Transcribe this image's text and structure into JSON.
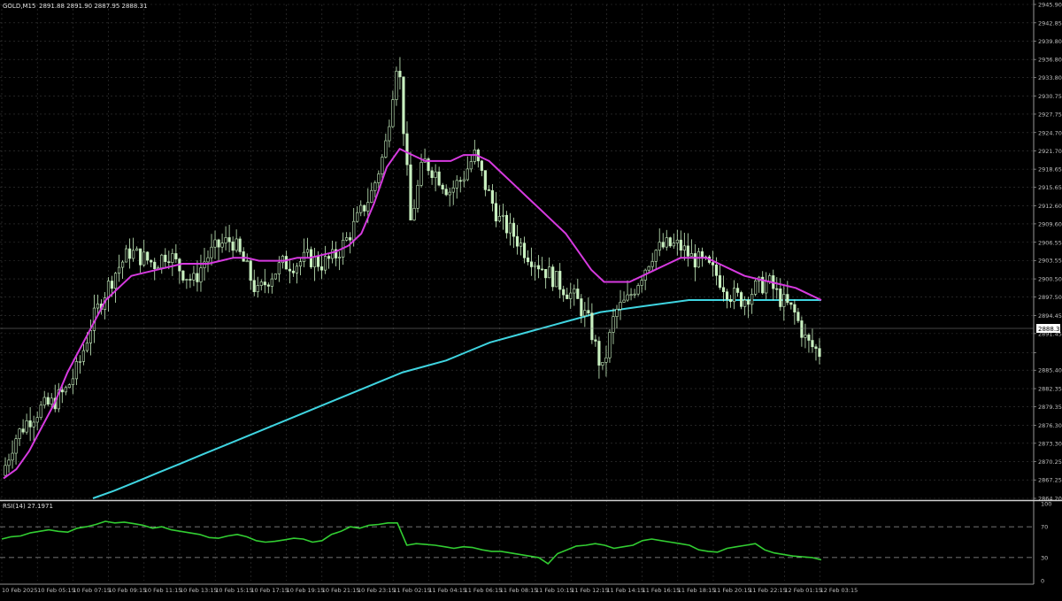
{
  "header": {
    "symbol": "GOLD,M15",
    "ohlc": "2891.88 2891.90 2887.95 2888.31"
  },
  "rsi_header": {
    "label": "RSI(14) 27.1971"
  },
  "current_price_label": "2888.31",
  "colors": {
    "background": "#000000",
    "grid": "#3a3a3a",
    "candle": "#c8f0c0",
    "ma_fast": "#d63adf",
    "ma_slow": "#3fd4e0",
    "rsi": "#32cd32",
    "axis": "#bfbfbf",
    "text": "#e0e0e0"
  },
  "chart_data": [
    {
      "type": "line",
      "title": "GOLD,M15",
      "ylim": [
        2864.2,
        2945.9
      ],
      "y_ticks": [
        "2945.90",
        "2942.85",
        "2939.80",
        "2936.80",
        "2933.80",
        "2930.75",
        "2927.75",
        "2924.70",
        "2921.70",
        "2918.65",
        "2915.65",
        "2912.60",
        "2909.60",
        "2906.55",
        "2903.55",
        "2900.50",
        "2897.50",
        "2894.45",
        "2891.45",
        "2888.31",
        "2885.40",
        "2882.35",
        "2879.35",
        "2876.30",
        "2873.30",
        "2870.25",
        "2867.25",
        "2864.20"
      ],
      "x_ticks": [
        "10 Feb 2025",
        "10 Feb 05:15",
        "10 Feb 07:15",
        "10 Feb 09:15",
        "10 Feb 11:15",
        "10 Feb 13:15",
        "10 Feb 15:15",
        "10 Feb 17:15",
        "10 Feb 19:15",
        "10 Feb 21:15",
        "10 Feb 23:15",
        "11 Feb 02:15",
        "11 Feb 04:15",
        "11 Feb 06:15",
        "11 Feb 08:15",
        "11 Feb 10:15",
        "11 Feb 12:15",
        "11 Feb 14:15",
        "11 Feb 16:15",
        "11 Feb 18:15",
        "11 Feb 20:15",
        "11 Feb 22:15",
        "12 Feb 01:15",
        "12 Feb 03:15"
      ],
      "price_path": [
        2868,
        2874,
        2877,
        2879,
        2880,
        2882,
        2886,
        2893,
        2898,
        2902,
        2905,
        2904,
        2903,
        2905,
        2902,
        2900,
        2904,
        2906,
        2907,
        2903,
        2898,
        2901,
        2903,
        2903,
        2904,
        2903,
        2904,
        2907,
        2911,
        2915,
        2922,
        2938,
        2910,
        2920,
        2918,
        2915,
        2917,
        2921,
        2915,
        2910,
        2908,
        2905,
        2903,
        2901,
        2899,
        2897,
        2893,
        2885,
        2895,
        2897,
        2901,
        2905,
        2906,
        2906,
        2904,
        2903,
        2901,
        2898,
        2897,
        2899,
        2900,
        2897,
        2895,
        2890,
        2888.31
      ],
      "series": [
        {
          "values": [
            2867.5,
            2869,
            2872,
            2876,
            2880,
            2885,
            2889,
            2893,
            2897,
            2899,
            2901,
            2901.5,
            2902,
            2902.5,
            2903,
            2903,
            2903,
            2903.5,
            2904,
            2904,
            2903.5,
            2903.5,
            2903.5,
            2904,
            2904,
            2904.5,
            2905,
            2906,
            2908,
            2913,
            2919,
            2922,
            2921,
            2920,
            2920,
            2920,
            2921,
            2921,
            2920,
            2918,
            2916,
            2914,
            2912,
            2910,
            2908,
            2905,
            2902,
            2900,
            2900,
            2900,
            2901,
            2902,
            2903,
            2904,
            2904,
            2904,
            2903,
            2902,
            2901,
            2900.5,
            2900,
            2899.5,
            2899,
            2898,
            2897
          ]
        },
        {
          "values": [
            2864.2,
            2865.5,
            2867,
            2868.5,
            2870,
            2871.5,
            2873,
            2874.5,
            2876,
            2877.5,
            2879,
            2880.5,
            2882,
            2883.5,
            2885,
            2886,
            2887,
            2888.5,
            2890,
            2891,
            2892,
            2893,
            2894,
            2895,
            2895.5,
            2896,
            2896.5,
            2897,
            2897,
            2897,
            2897,
            2897,
            2897,
            2897
          ]
        },
        {
          "name": "RSI(14)",
          "ylim": [
            0,
            100
          ],
          "levels": [
            70,
            30
          ],
          "y_ticks": [
            "100",
            "70",
            "30",
            "0"
          ],
          "values": [
            54,
            57,
            58,
            62,
            64,
            66,
            64,
            63,
            68,
            70,
            73,
            77,
            75,
            76,
            74,
            72,
            68,
            70,
            66,
            64,
            62,
            60,
            56,
            55,
            58,
            60,
            57,
            52,
            50,
            51,
            53,
            55,
            54,
            50,
            52,
            60,
            64,
            70,
            68,
            72,
            73,
            75,
            75,
            46,
            48,
            47,
            46,
            44,
            42,
            44,
            43,
            40,
            38,
            38,
            36,
            34,
            32,
            30,
            22,
            35,
            40,
            45,
            46,
            48,
            46,
            42,
            44,
            46,
            52,
            54,
            52,
            50,
            48,
            46,
            40,
            38,
            37,
            42,
            44,
            46,
            48,
            40,
            36,
            34,
            32,
            31,
            30,
            27
          ]
        }
      ]
    }
  ]
}
